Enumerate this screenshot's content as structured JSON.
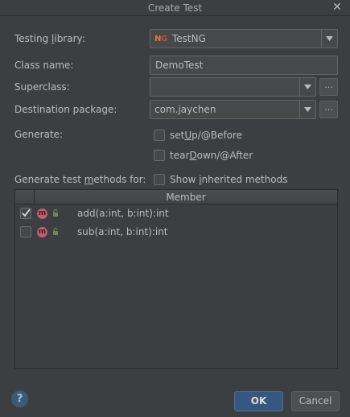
{
  "window": {
    "title": "Create Test",
    "close_glyph": "✕"
  },
  "form": {
    "testing_library": {
      "label_pre": "Testing ",
      "label_u": "l",
      "label_post": "ibrary:",
      "value": "TestNG",
      "icon": "testng-icon"
    },
    "class_name": {
      "label": "Class name:",
      "value": "DemoTest"
    },
    "superclass": {
      "label": "Superclass:",
      "value": ""
    },
    "destination_package": {
      "label": "Destination package:",
      "value": "com.jaychen"
    },
    "ellipsis_label": "..."
  },
  "generate": {
    "label": "Generate:",
    "setup": {
      "pre": "set",
      "u": "U",
      "post": "p/@Before",
      "checked": false
    },
    "teardown": {
      "pre": "tear",
      "u": "D",
      "post": "own/@After",
      "checked": false
    }
  },
  "methods": {
    "label_pre": "Generate test ",
    "label_u": "m",
    "label_post": "ethods for:",
    "show_inherited": {
      "pre": "Show ",
      "u": "i",
      "post": "nherited methods",
      "checked": false
    }
  },
  "table": {
    "header": "Member",
    "rows": [
      {
        "signature": "add(a:int, b:int):int",
        "checked": true,
        "badge": "m"
      },
      {
        "signature": "sub(a:int, b:int):int",
        "checked": false,
        "badge": "m"
      }
    ]
  },
  "footer": {
    "help": "?",
    "ok": "OK",
    "cancel": "Cancel"
  },
  "colors": {
    "background": "#3c3f41",
    "field": "#45494a",
    "ok_button": "#365880",
    "method_badge": "#c85a6f",
    "access_lock": "#6a8759"
  }
}
